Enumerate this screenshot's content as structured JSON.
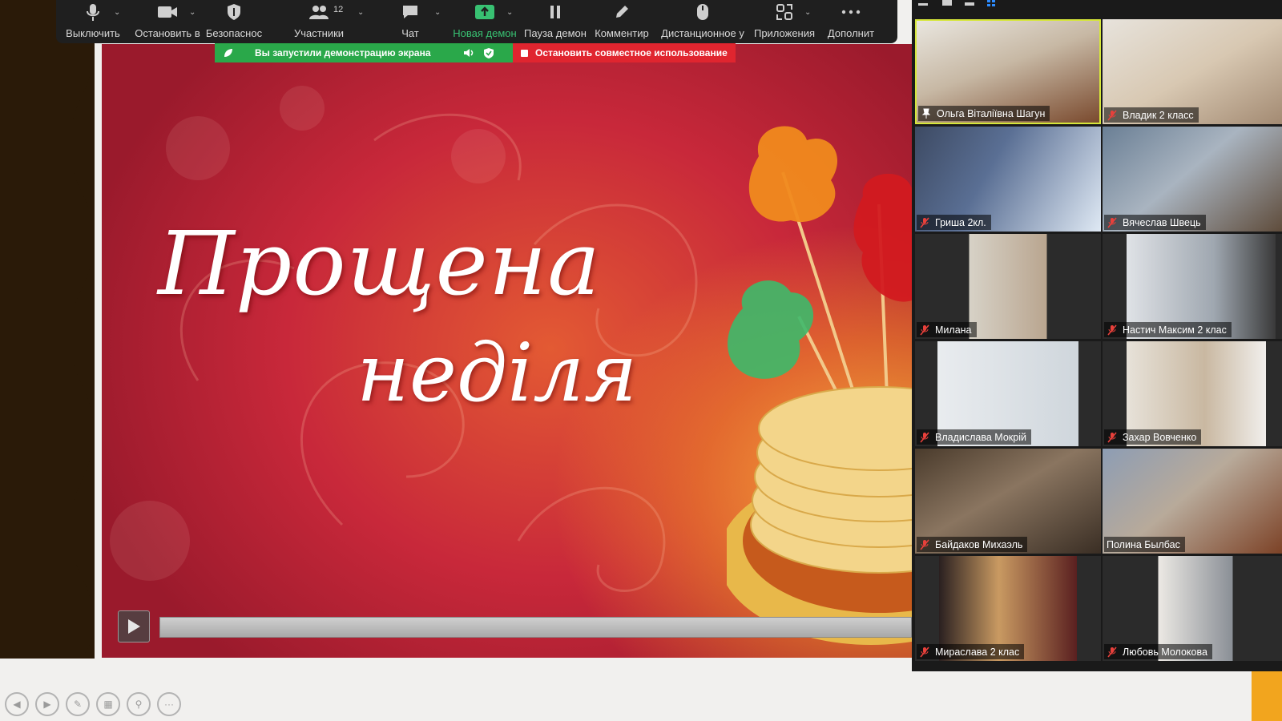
{
  "toolbar": {
    "buttons": [
      {
        "label": "Выключить",
        "icon": "microphone-icon"
      },
      {
        "label": "Остановить в",
        "icon": "video-camera-icon"
      },
      {
        "label": "Безопаснос",
        "icon": "shield-icon"
      },
      {
        "label": "Участники",
        "icon": "participants-icon",
        "count": "12"
      },
      {
        "label": "Чат",
        "icon": "chat-bubble-icon"
      },
      {
        "label": "Новая демон",
        "icon": "share-screen-icon",
        "color": "#38c172"
      },
      {
        "label": "Пауза демон",
        "icon": "pause-icon"
      },
      {
        "label": "Комментир",
        "icon": "pencil-icon"
      },
      {
        "label": "Дистанционное у",
        "icon": "mouse-icon"
      },
      {
        "label": "Приложения",
        "icon": "apps-icon"
      },
      {
        "label": "Дополнит",
        "icon": "more-dots-icon"
      }
    ]
  },
  "share_status": {
    "message": "Вы запустили демонстрацию экрана",
    "stop_label": "Остановить совместное использование",
    "status_color": "#2aa84a",
    "stop_color": "#e0252f"
  },
  "slide": {
    "title_line1": "Прощена",
    "title_line2": "неділя"
  },
  "gallery": {
    "participants": [
      {
        "name": "Ольга Віталіївна Шагун",
        "pinned": true,
        "active": true
      },
      {
        "name": "Владик 2 класс",
        "muted": true
      },
      {
        "name": "Гриша 2кл.",
        "muted": true
      },
      {
        "name": "Вячеслав Швець",
        "muted": true
      },
      {
        "name": "Милана",
        "muted": true
      },
      {
        "name": "Настич Максим 2 клас",
        "muted": true
      },
      {
        "name": "Владислава Мокрій",
        "muted": true
      },
      {
        "name": "Захар Вовченко",
        "muted": true
      },
      {
        "name": "Байдаков Михаэль",
        "muted": true
      },
      {
        "name": "Полина Былбас",
        "muted": true
      },
      {
        "name": "Мираслава 2 клас",
        "muted": true
      },
      {
        "name": "Любовь Молокова",
        "muted": true
      }
    ]
  },
  "colors": {
    "accent_yellow": "#d6e63a",
    "corner_orange": "#f2a51e"
  }
}
